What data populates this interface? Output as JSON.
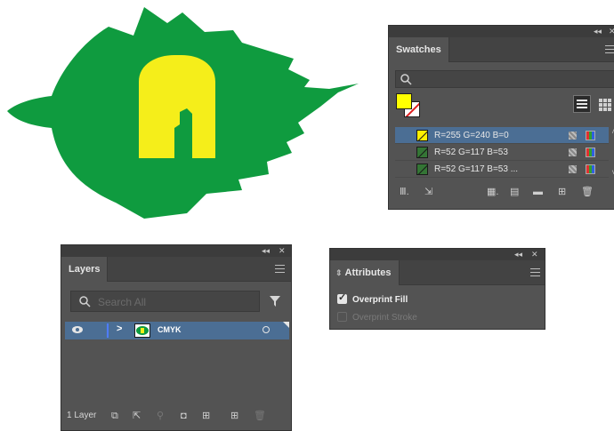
{
  "artwork": {
    "leaf_color": "#0f9b3f",
    "letter_color": "#f5ee1a",
    "letter": "A"
  },
  "swatches_panel": {
    "title": "Swatches",
    "collapse_icon": "double-chevron-left-icon",
    "close_icon": "close-icon",
    "fill_color": "#ffff00",
    "stroke": "none",
    "swatches": [
      {
        "label": "R=255 G=240 B=0",
        "color": "#fff000",
        "selected": true
      },
      {
        "label": "R=52 G=117 B=53",
        "color": "#347535",
        "selected": false
      },
      {
        "label": "R=52 G=117 B=53 ...",
        "color": "#347535",
        "selected": false
      }
    ],
    "bottom_icons": [
      "swatch-libraries-icon",
      "place-swatches-icon",
      "show-kinds-icon",
      "swatch-options-icon",
      "new-color-group-icon",
      "new-swatch-icon",
      "delete-icon"
    ]
  },
  "layers_panel": {
    "title": "Layers",
    "search_placeholder": "Search All",
    "layer": {
      "name": "CMYK",
      "visible": true
    },
    "layer_count": "1 Layer",
    "bottom_icons": [
      "collect-for-export-icon",
      "export-icon",
      "locate-object-icon",
      "make-clipping-mask-icon",
      "create-sublayer-icon",
      "new-layer-icon",
      "delete-icon"
    ]
  },
  "attributes_panel": {
    "title": "Attributes",
    "overprint_fill": {
      "label": "Overprint Fill",
      "checked": true
    },
    "overprint_stroke": {
      "label": "Overprint Stroke",
      "checked": false,
      "disabled": true
    }
  }
}
